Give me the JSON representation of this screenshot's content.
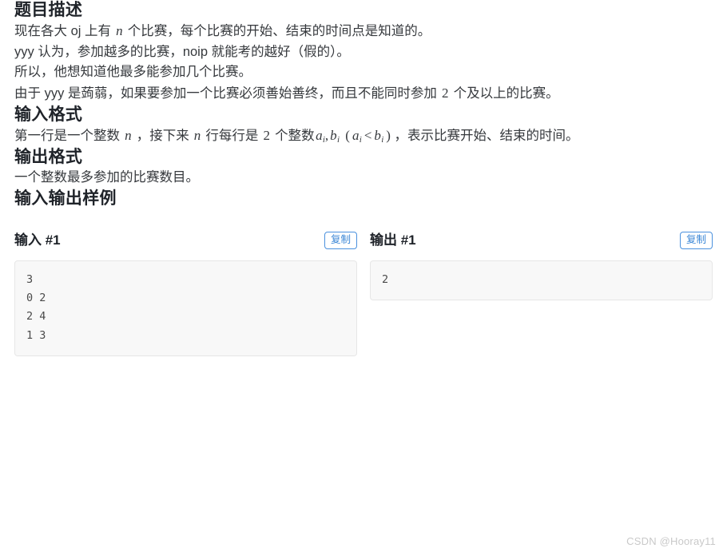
{
  "sections": {
    "description": {
      "heading": "题目描述",
      "paragraphs": {
        "p1_a": "现在各大 oj 上有",
        "p1_math": "n",
        "p1_b": "个比赛，每个比赛的开始、结束的时间点是知道的。",
        "p2": "yyy 认为，参加越多的比赛，noip 就能考的越好（假的）。",
        "p3": "所以，他想知道他最多能参加几个比赛。",
        "p4_a": "由于 yyy 是蒟蒻，如果要参加一个比赛必须善始善终，而且不能同时参加",
        "p4_math": "2",
        "p4_b": "个及以上的比赛。"
      }
    },
    "input_format": {
      "heading": "输入格式",
      "text_a": "第一行是一个整数",
      "math_n1": "n",
      "text_b": "，接下来",
      "math_n2": "n",
      "text_c": "行每行是",
      "math_2": "2",
      "text_d": "个整数",
      "math_ab": "a_i, b_i (a_i < b_i)",
      "text_e": "，表示比赛开始、结束的时间。"
    },
    "output_format": {
      "heading": "输出格式",
      "text": "一个整数最多参加的比赛数目。"
    },
    "samples": {
      "heading": "输入输出样例",
      "input": {
        "title": "输入 #1",
        "copy_label": "复制",
        "content": "3\n0 2\n2 4\n1 3"
      },
      "output": {
        "title": "输出 #1",
        "copy_label": "复制",
        "content": "2"
      }
    }
  },
  "watermark": "CSDN @Hooray11",
  "colors": {
    "accent": "#4b91de",
    "heading": "#1f2329",
    "body": "#36393d",
    "code_bg": "#f8f8f8",
    "code_border": "#e6e6e6",
    "watermark": "#c9c9c9"
  }
}
